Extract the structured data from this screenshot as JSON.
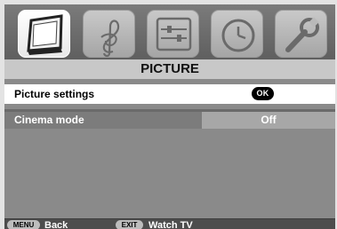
{
  "menu": {
    "tabs": [
      {
        "name": "picture",
        "icon": "tv-screen-icon",
        "active": true
      },
      {
        "name": "sound",
        "icon": "treble-clef-icon",
        "active": false
      },
      {
        "name": "setup",
        "icon": "sliders-icon",
        "active": false
      },
      {
        "name": "timers",
        "icon": "clock-icon",
        "active": false
      },
      {
        "name": "tools",
        "icon": "wrench-icon",
        "active": false
      }
    ],
    "title": "PICTURE",
    "rows": [
      {
        "label": "Picture settings",
        "action": "OK"
      },
      {
        "label": "Cinema mode",
        "value": "Off"
      }
    ]
  },
  "footer": {
    "menu_key": "MENU",
    "back_label": "Back",
    "exit_key": "EXIT",
    "watch_label": "Watch TV"
  },
  "colors": {
    "panel": "#8a8a8a",
    "active_tab": "#ffffff",
    "inactive_tab": "#b5b5b5",
    "selected_row": "#ffffff",
    "footer": "#4d4d4d"
  }
}
